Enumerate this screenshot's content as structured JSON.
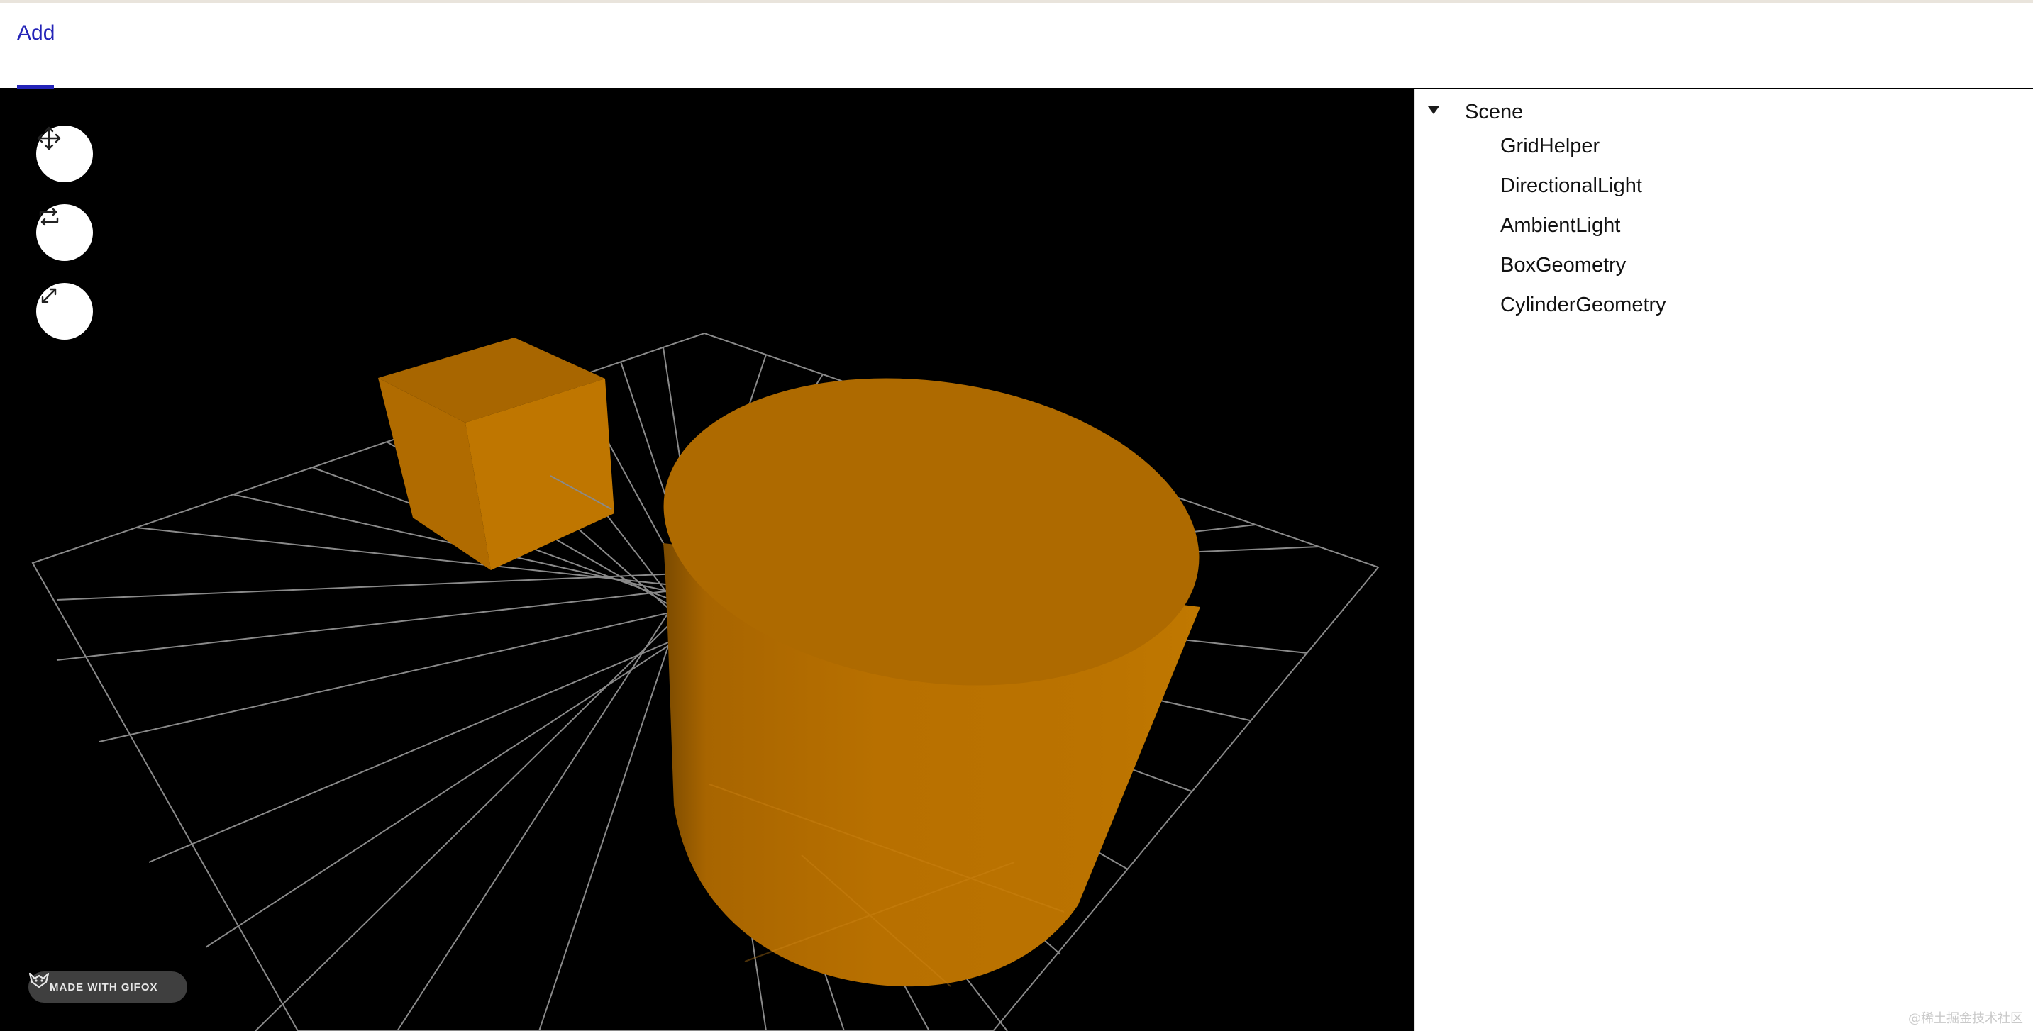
{
  "menu": {
    "tabs": [
      {
        "label": "Add"
      }
    ]
  },
  "toolbar": {
    "buttons": [
      {
        "icon": "move-arrows-icon"
      },
      {
        "icon": "rotate-arrows-icon"
      },
      {
        "icon": "scale-arrows-icon"
      }
    ]
  },
  "scene": {
    "object_color": "#b87000",
    "grid_color": "#8a8a8a"
  },
  "badge": {
    "label": "MADE WITH GIFOX"
  },
  "outliner": {
    "root_label": "Scene",
    "items": [
      {
        "label": "GridHelper"
      },
      {
        "label": "DirectionalLight"
      },
      {
        "label": "AmbientLight"
      },
      {
        "label": "BoxGeometry"
      },
      {
        "label": "CylinderGeometry"
      }
    ]
  },
  "watermark": {
    "text": "@稀土掘金技术社区"
  }
}
